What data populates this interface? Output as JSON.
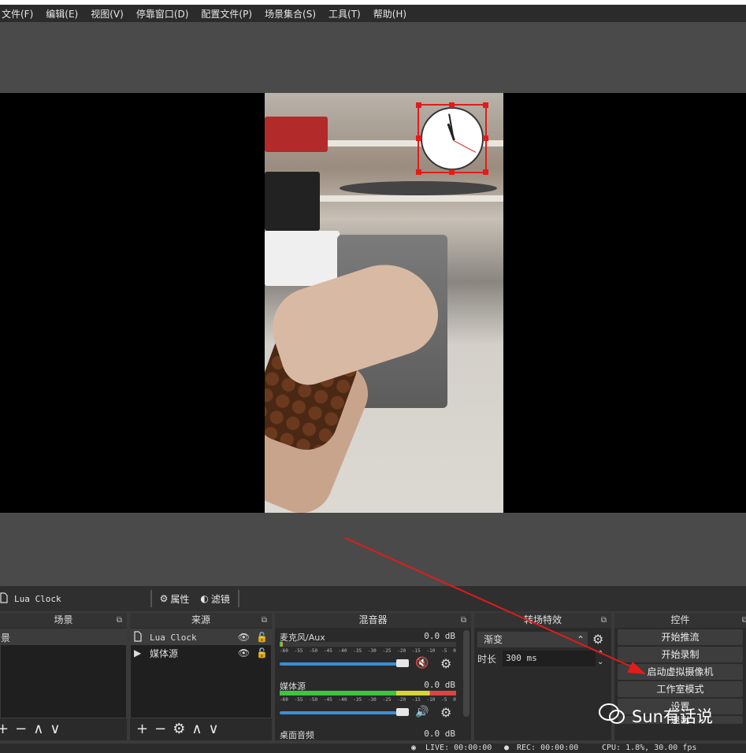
{
  "menu": [
    "文件(F)",
    "编辑(E)",
    "视图(V)",
    "停靠窗口(D)",
    "配置文件(P)",
    "场景集合(S)",
    "工具(T)",
    "帮助(H)"
  ],
  "context_bar": {
    "source_name": "Lua Clock",
    "properties": "属性",
    "filters": "滤镜"
  },
  "scenes": {
    "title": "场景",
    "items": [
      "景"
    ]
  },
  "sources": {
    "title": "来源",
    "items": [
      {
        "icon": "file-icon",
        "name": "Lua Clock"
      },
      {
        "icon": "play-icon",
        "name": "媒体源"
      }
    ]
  },
  "mixer": {
    "title": "混音器",
    "tracks": [
      {
        "name": "麦克风/Aux",
        "db": "0.0 dB",
        "muted": true
      },
      {
        "name": "媒体源",
        "db": "0.0 dB",
        "muted": false
      },
      {
        "name": "桌面音频",
        "db": "0.0 dB",
        "muted": false
      }
    ],
    "ticks": [
      "-60",
      "-55",
      "-50",
      "-45",
      "-40",
      "-35",
      "-30",
      "-25",
      "-20",
      "-15",
      "-10",
      "-5",
      "0"
    ]
  },
  "transitions": {
    "title": "转场特效",
    "selected": "渐变",
    "duration_label": "时长",
    "duration_value": "300 ms"
  },
  "controls": {
    "title": "控件",
    "buttons": [
      "开始推流",
      "开始录制",
      "启动虚拟摄像机",
      "工作室模式",
      "设置",
      "退出"
    ]
  },
  "status": {
    "live": "LIVE: 00:00:00",
    "rec": "REC: 00:00:00",
    "cpu": "CPU: 1.8%, 30.00 fps"
  },
  "watermark": "Sun有话说",
  "colors": {
    "accent_red": "#e21b1b",
    "volume_blue": "#3a8fd8"
  }
}
